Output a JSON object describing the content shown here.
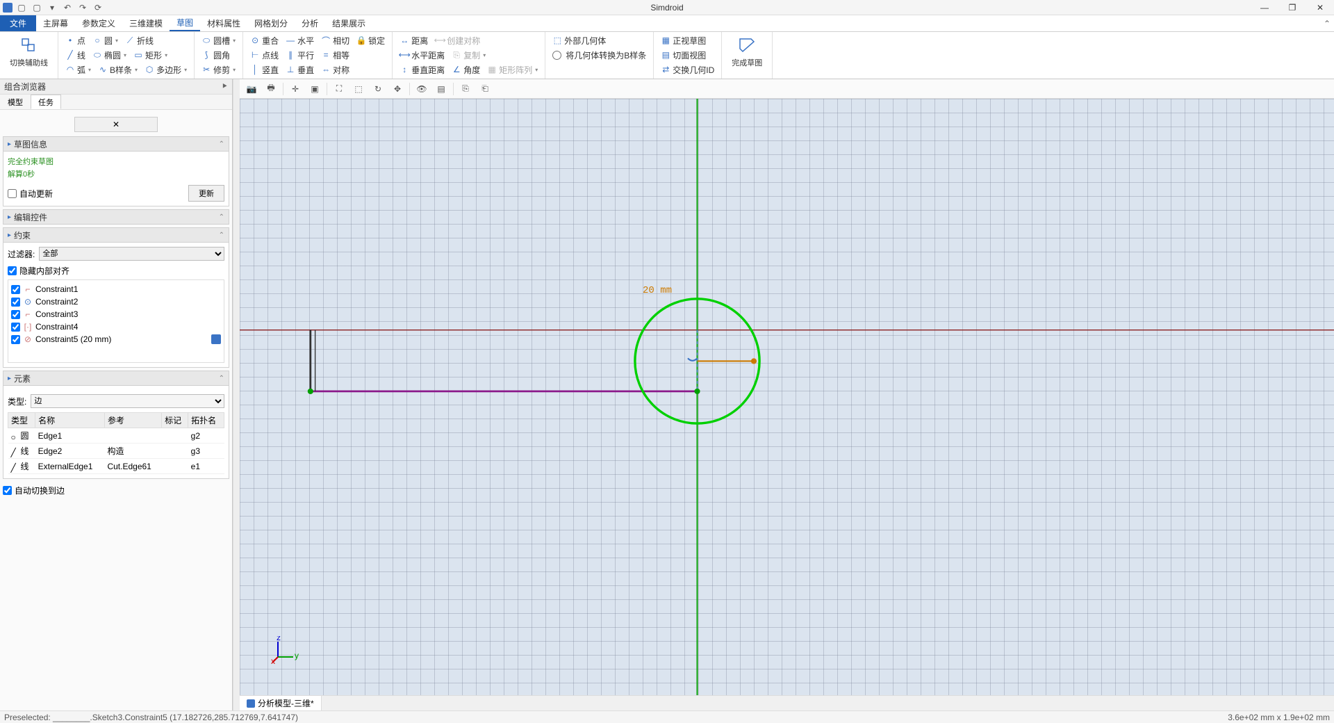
{
  "app": {
    "title": "Simdroid"
  },
  "menu": {
    "file": "文件",
    "items": [
      "主屏幕",
      "参数定义",
      "三维建模",
      "草图",
      "材料属性",
      "网格划分",
      "分析",
      "结果展示"
    ],
    "active_index": 3
  },
  "ribbon": {
    "g0_label": "切换辅助线",
    "draw": {
      "r0": [
        "点",
        "圆",
        "折线"
      ],
      "r1": [
        "线",
        "椭圆",
        "矩形"
      ],
      "r2": [
        "弧",
        "B样条",
        "多边形"
      ]
    },
    "edit": {
      "r0": [
        "圆槽"
      ],
      "r1": [
        "圆角"
      ],
      "r2": [
        "修剪"
      ]
    },
    "constrain": {
      "r0": [
        "重合",
        "水平",
        "相切",
        "锁定"
      ],
      "r1": [
        "点线",
        "平行",
        "相等",
        ""
      ],
      "r2": [
        "竖直",
        "垂直",
        "对称",
        ""
      ]
    },
    "dim": {
      "r0": [
        "距离",
        "创建对称"
      ],
      "r1": [
        "水平距离",
        "复制"
      ],
      "r2": [
        "垂直距离",
        "角度",
        "矩形阵列"
      ]
    },
    "ext": {
      "r0": "外部几何体",
      "r1": "将几何体转换为B样条",
      "v0": "正视草图",
      "v1": "切面视图",
      "v2": "交换几何ID"
    },
    "finish": "完成草图"
  },
  "sidebar": {
    "header": "组合浏览器",
    "tabs": [
      "模型",
      "任务"
    ],
    "active_tab": 1,
    "sketch_info": {
      "title": "草图信息",
      "line1": "完全约束草图",
      "line2": "解算0秒",
      "auto_update": "自动更新",
      "update_btn": "更新"
    },
    "edit_ctrl": {
      "title": "编辑控件"
    },
    "constraints": {
      "title": "约束",
      "filter_label": "过滤器:",
      "filter_value": "全部",
      "hide_internal": "隐藏内部对齐",
      "items": [
        {
          "name": "Constraint1"
        },
        {
          "name": "Constraint2"
        },
        {
          "name": "Constraint3"
        },
        {
          "name": "Constraint4"
        },
        {
          "name": "Constraint5 (20 mm)",
          "editable": true
        }
      ]
    },
    "elements": {
      "title": "元素",
      "type_label": "类型:",
      "type_value": "边",
      "cols": [
        "类型",
        "名称",
        "参考",
        "标记",
        "拓扑名"
      ],
      "rows": [
        {
          "t": "圆",
          "n": "Edge1",
          "r": "",
          "m": "",
          "topo": "g2"
        },
        {
          "t": "线",
          "n": "Edge2",
          "r": "构造",
          "m": "",
          "topo": "g3"
        },
        {
          "t": "线",
          "n": "ExternalEdge1",
          "r": "Cut.Edge61",
          "m": "",
          "topo": "e1"
        }
      ]
    },
    "auto_snap": "自动切换到边"
  },
  "canvas": {
    "dim_label": "20 mm",
    "doc_tab": "分析模型-三维*"
  },
  "status": {
    "left": "Preselected: ________.Sketch3.Constraint5 (17.182726,285.712769,7.641747)",
    "right": "3.6e+02 mm x 1.9e+02 mm"
  }
}
